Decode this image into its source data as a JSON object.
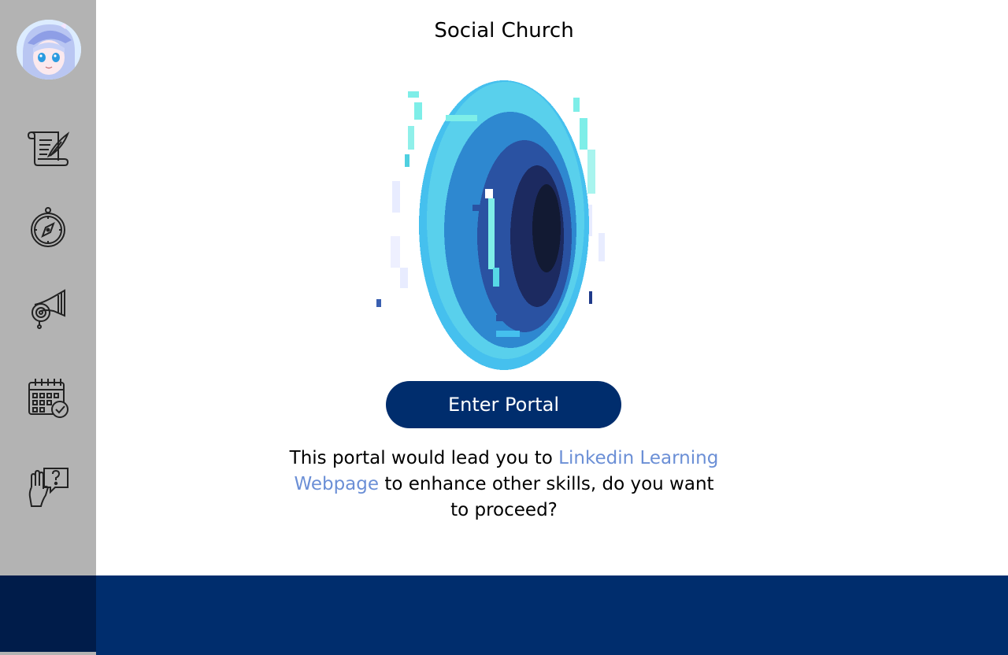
{
  "page": {
    "title": "Social Church"
  },
  "portal": {
    "button_label": "Enter Portal",
    "description_before": "This portal would lead you to ",
    "description_link": "Linkedin Learning Webpage",
    "description_after": " to enhance other skills, do you want to proceed?"
  },
  "sidebar": {
    "items": [
      {
        "icon": "scroll-quill-icon"
      },
      {
        "icon": "compass-icon"
      },
      {
        "icon": "horn-icon"
      },
      {
        "icon": "calendar-check-icon"
      },
      {
        "icon": "raised-hand-question-icon"
      }
    ]
  },
  "colors": {
    "sidebar_bg": "#b3b3b3",
    "brand_navy": "#002d6d",
    "sidebar_footer": "#001c4a",
    "link": "#6b8fd6"
  }
}
